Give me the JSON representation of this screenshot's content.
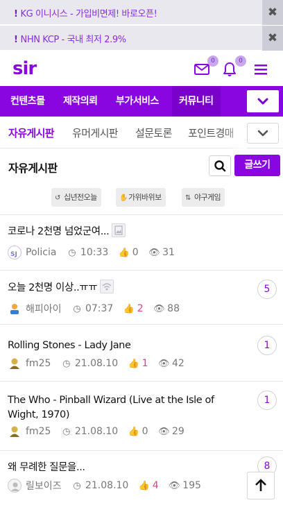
{
  "ads": [
    {
      "mark": "!",
      "text": "KG 이니시스 - 가입비면제! 바로오픈!"
    },
    {
      "mark": "!",
      "text": "NHN KCP - 국내 최저 2.9%"
    }
  ],
  "header": {
    "logo": "sir",
    "mail_badge": "0",
    "bell_badge": "0"
  },
  "nav": {
    "items": [
      "컨텐츠몰",
      "제작의뢰",
      "부가서비스",
      "커뮤니티"
    ],
    "active": "커뮤니티"
  },
  "subnav": {
    "items": [
      "자유게시판",
      "유머게시판",
      "설문토론",
      "포인트경매"
    ],
    "active": "자유게시판"
  },
  "board": {
    "title": "자유게시판",
    "write_label": "글쓰기"
  },
  "chips": [
    {
      "icon": "history-icon",
      "label": "십년전오늘"
    },
    {
      "icon": "hand-icon",
      "label": "가위바위보"
    },
    {
      "icon": "sort-icon",
      "label": "야구게임"
    }
  ],
  "posts": [
    {
      "title": "코로나 2천명 넘었군여...",
      "title_icon": "image-icon",
      "author": "Policia",
      "time": "10:33",
      "likes": "0",
      "views": "31",
      "comments": "",
      "liked": false
    },
    {
      "title": "오늘 2천명 이상..ㅠㅠ",
      "title_icon": "wifi-icon",
      "author": "해피아이",
      "time": "07:37",
      "likes": "2",
      "views": "88",
      "comments": "5",
      "liked": true
    },
    {
      "title": "Rolling Stones - Lady Jane",
      "title_icon": "",
      "author": "fm25",
      "time": "21.08.10",
      "likes": "1",
      "views": "42",
      "comments": "1",
      "liked": true
    },
    {
      "title": "The Who - Pinball Wizard (Live at the Isle of Wight, 1970)",
      "title_icon": "",
      "author": "fm25",
      "time": "21.08.10",
      "likes": "0",
      "views": "29",
      "comments": "1",
      "liked": false
    },
    {
      "title": "왜 무례한 질문을...",
      "title_icon": "",
      "author": "릴보이즈",
      "time": "21.08.10",
      "likes": "4",
      "views": "195",
      "comments": "8",
      "liked": true
    }
  ]
}
